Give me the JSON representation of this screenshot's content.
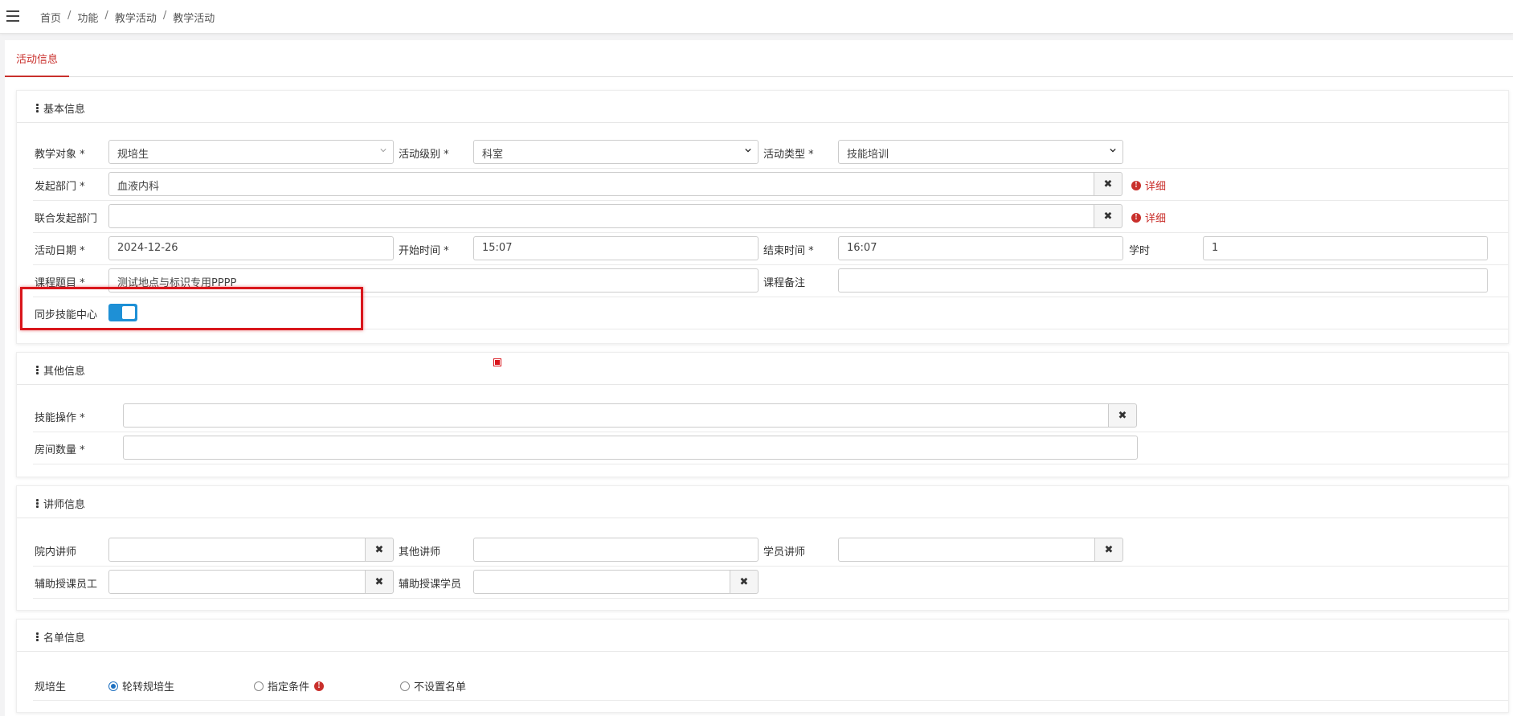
{
  "breadcrumb": [
    "首页",
    "功能",
    "教学活动",
    "教学活动"
  ],
  "tabs": {
    "active": "活动信息"
  },
  "basic": {
    "title": "基本信息",
    "target_label": "教学对象 *",
    "target_value": "规培生",
    "level_label": "活动级别 *",
    "level_value": "科室",
    "type_label": "活动类型 *",
    "type_value": "技能培训",
    "dept_label": "发起部门 *",
    "dept_value": "血液内科",
    "detail": "详细",
    "joint_label": "联合发起部门",
    "joint_value": "",
    "date_label": "活动日期 *",
    "date_value": "2024-12-26",
    "start_label": "开始时间 *",
    "start_value": "15:07",
    "end_label": "结束时间 *",
    "end_value": "16:07",
    "hours_label": "学时",
    "hours_value": "1",
    "topic_label": "课程题目 *",
    "topic_value": "测试地点与标识专用PPPP",
    "remark_label": "课程备注",
    "remark_value": "",
    "sync_label": "同步技能中心",
    "sync_on": true
  },
  "other": {
    "title": "其他信息",
    "skill_label": "技能操作 *",
    "skill_value": "",
    "rooms_label": "房间数量 *",
    "rooms_value": ""
  },
  "lecturer": {
    "title": "讲师信息",
    "internal_label": "院内讲师",
    "other_label": "其他讲师",
    "student_label": "学员讲师",
    "assist_staff_label": "辅助授课员工",
    "assist_student_label": "辅助授课学员"
  },
  "roster": {
    "title": "名单信息",
    "label": "规培生",
    "options": [
      "轮转规培生",
      "指定条件",
      "不设置名单"
    ],
    "selected": "轮转规培生"
  },
  "colors": {
    "accent": "#c9302c",
    "toggle": "#1e90d6",
    "highlight": "#d9161c"
  }
}
